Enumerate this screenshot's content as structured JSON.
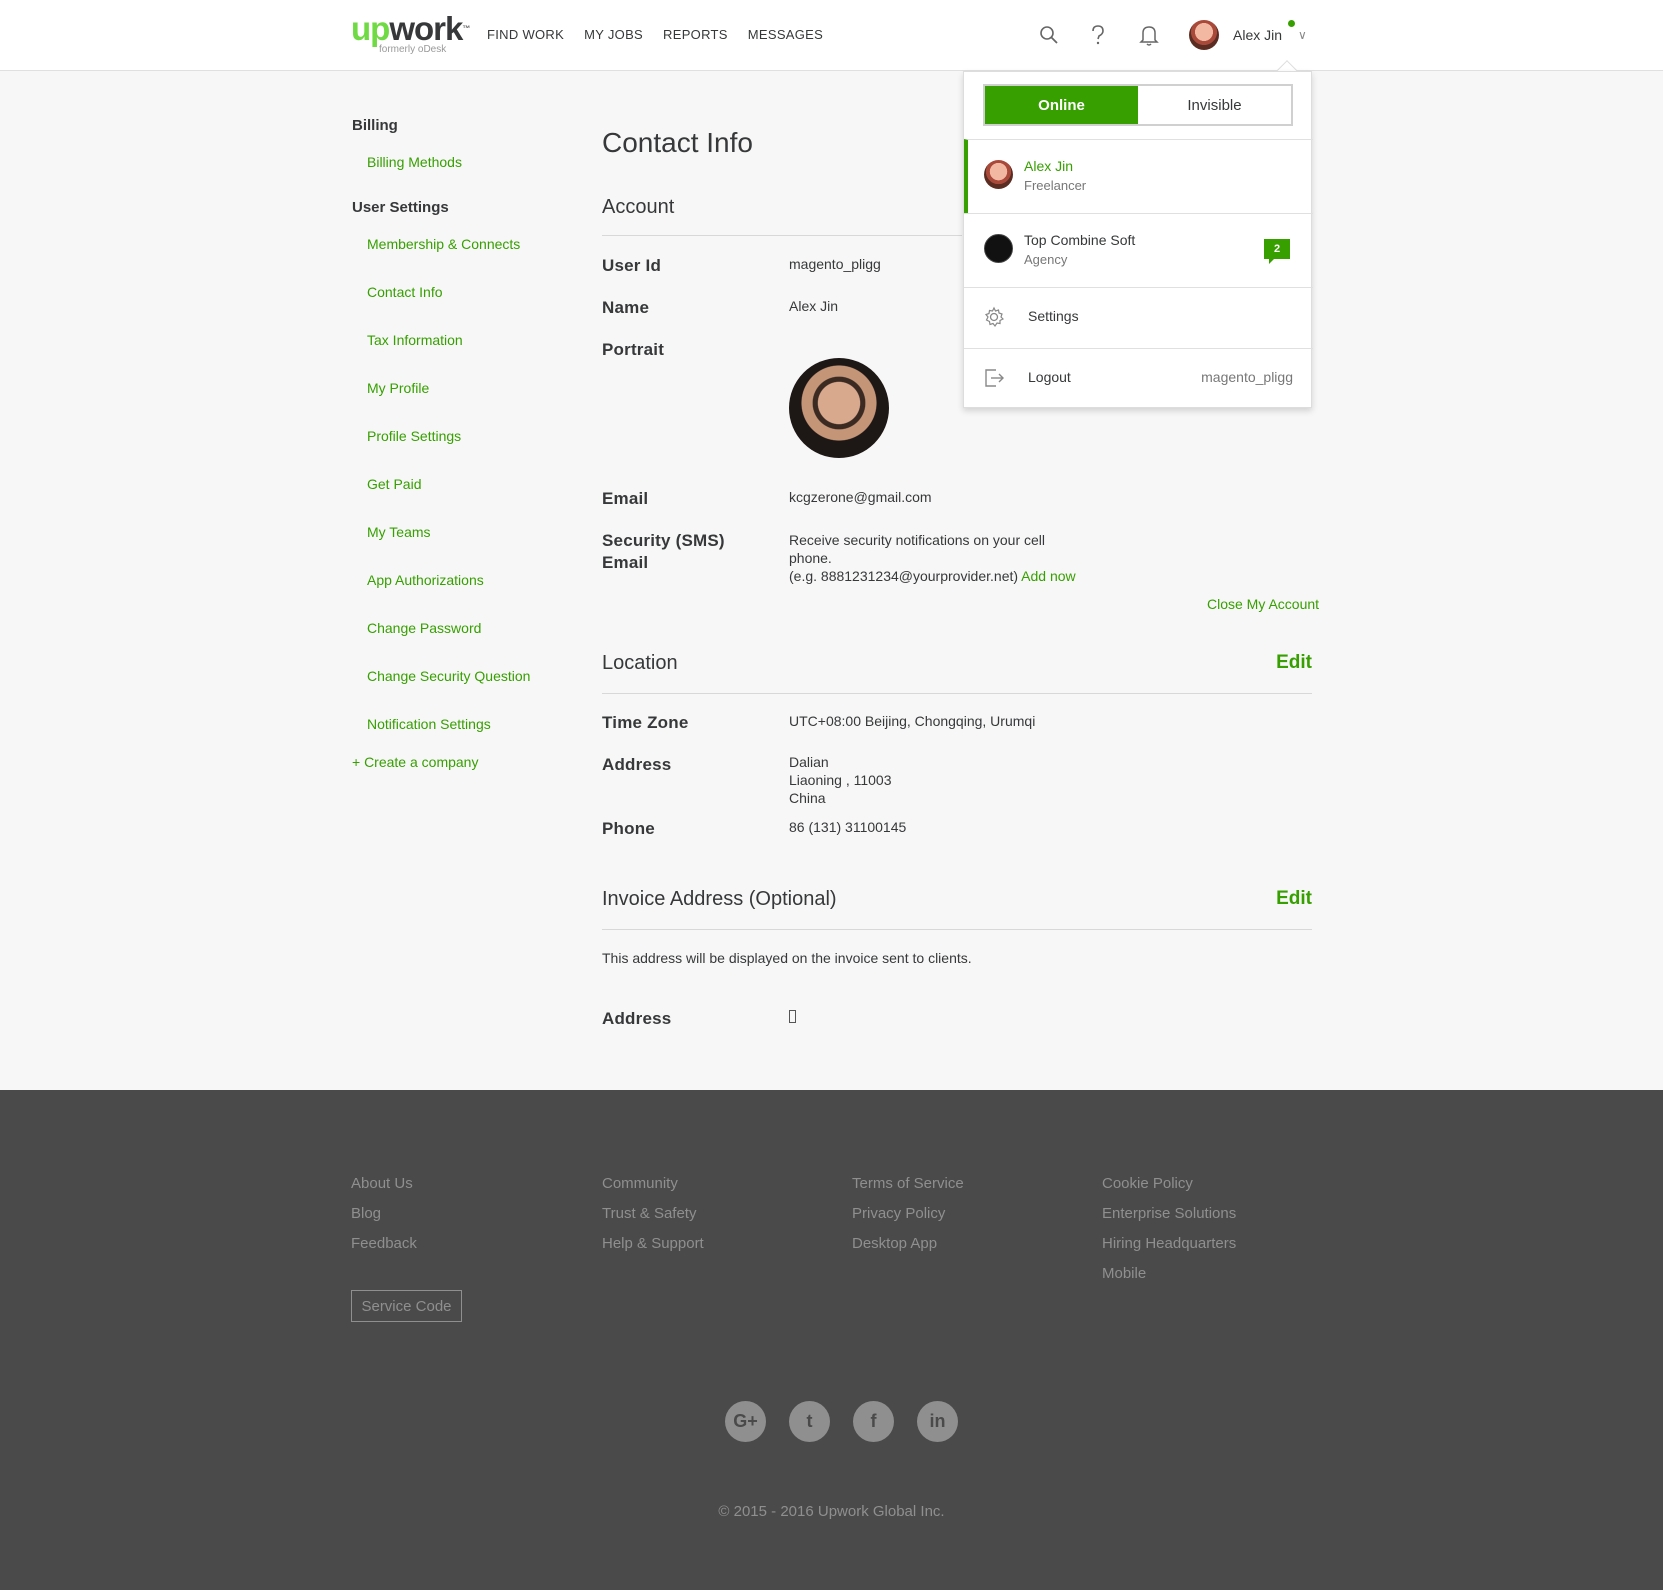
{
  "header": {
    "logo_up": "up",
    "logo_work": "work",
    "logo_tm": "™",
    "logo_sub": "formerly oDesk",
    "nav": [
      "FIND WORK",
      "MY JOBS",
      "REPORTS",
      "MESSAGES"
    ],
    "user_name": "Alex Jin",
    "icons": [
      "search-icon",
      "help-icon",
      "bell-icon"
    ]
  },
  "sidebar": {
    "billing_heading": "Billing",
    "billing_items": [
      "Billing Methods"
    ],
    "user_settings_heading": "User Settings",
    "user_items": [
      "Membership & Connects",
      "Contact Info",
      "Tax Information",
      "My Profile",
      "Profile Settings",
      "Get Paid",
      "My Teams",
      "App Authorizations",
      "Change Password",
      "Change Security Question",
      "Notification Settings"
    ],
    "create_company": "+ Create a company"
  },
  "main": {
    "title": "Contact Info",
    "account": {
      "heading": "Account",
      "user_id_label": "User Id",
      "user_id": "magento_pligg",
      "name_label": "Name",
      "name": "Alex Jin",
      "portrait_label": "Portrait",
      "email_label": "Email",
      "email": "kcgzerone@gmail.com",
      "sms_label_1": "Security (SMS)",
      "sms_label_2": "Email",
      "sms_text_1": "Receive security notifications on your cell",
      "sms_text_2": "phone.",
      "sms_text_3": "(e.g. 8881231234@yourprovider.net)",
      "add_now": "Add now",
      "close_account": "Close My Account"
    },
    "location": {
      "heading": "Location",
      "edit": "Edit",
      "timezone_label": "Time Zone",
      "timezone": "UTC+08:00 Beijing, Chongqing, Urumqi",
      "address_label": "Address",
      "address_1": "Dalian",
      "address_2": "Liaoning , 11003",
      "address_3": "China",
      "phone_label": "Phone",
      "phone": "86 (131) 31100145"
    },
    "invoice": {
      "heading": "Invoice Address (Optional)",
      "edit": "Edit",
      "note": "This address will be displayed on the invoice sent to clients.",
      "address_label": "Address"
    }
  },
  "dropdown": {
    "online": "Online",
    "invisible": "Invisible",
    "accounts": [
      {
        "name": "Alex Jin",
        "role": "Freelancer"
      },
      {
        "name": "Top Combine Soft",
        "role": "Agency",
        "badge": "2"
      }
    ],
    "settings": "Settings",
    "logout": "Logout",
    "logout_user": "magento_pligg"
  },
  "footer": {
    "col1": [
      "About Us",
      "Blog",
      "Feedback"
    ],
    "col2": [
      "Community",
      "Trust & Safety",
      "Help & Support"
    ],
    "col3": [
      "Terms of Service",
      "Privacy Policy",
      "Desktop App"
    ],
    "col4": [
      "Cookie Policy",
      "Enterprise Solutions",
      "Hiring Headquarters",
      "Mobile"
    ],
    "service_code": "Service Code",
    "social": [
      "G+",
      "t",
      "f",
      "in"
    ],
    "copyright": "© 2015 - 2016 Upwork Global Inc."
  },
  "colors": {
    "accent": "#37a000",
    "footer_bg": "#4a4a4a",
    "page_bg": "#f7f7f7"
  }
}
